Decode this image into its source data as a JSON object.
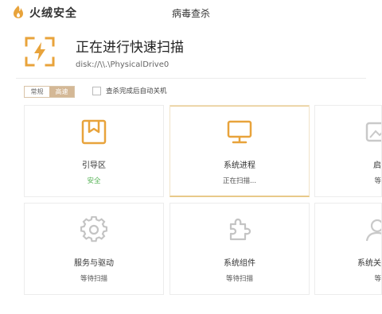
{
  "app": {
    "brand": "火绒安全",
    "window_title": "病毒查杀"
  },
  "scan": {
    "title": "正在进行快速扫描",
    "path": "disk://\\\\.\\PhysicalDrive0"
  },
  "options": {
    "mode_normal": "常规",
    "mode_fast": "高速",
    "auto_shutdown_label": "查杀完成后自动关机",
    "auto_shutdown_checked": false
  },
  "colors": {
    "accent": "#e8a33b",
    "safe": "#52b152",
    "icon_gray": "#bdbdbd"
  },
  "cards": [
    {
      "name": "引导区",
      "status": "安全",
      "icon": "bookmark-box-icon",
      "state": "safe"
    },
    {
      "name": "系统进程",
      "status": "正在扫描...",
      "icon": "monitor-icon",
      "state": "scanning"
    },
    {
      "name": "启",
      "status": "等",
      "icon": "image-icon",
      "state": "waiting"
    },
    {
      "name": "服务与驱动",
      "status": "等待扫描",
      "icon": "gear-icon",
      "state": "waiting"
    },
    {
      "name": "系统组件",
      "status": "等待扫描",
      "icon": "puzzle-icon",
      "state": "waiting"
    },
    {
      "name": "系统关",
      "status": "等",
      "icon": "user-icon",
      "state": "waiting"
    }
  ]
}
